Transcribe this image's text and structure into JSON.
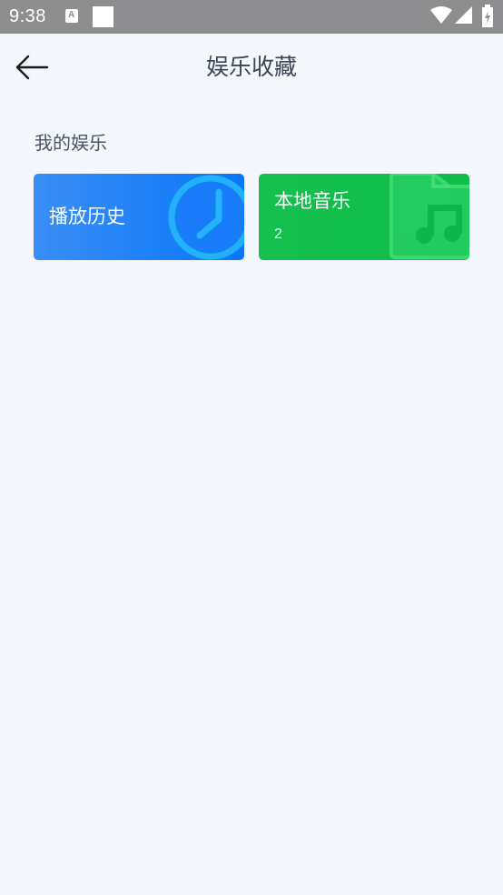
{
  "status_bar": {
    "time": "9:38",
    "app_icon_letter": "A"
  },
  "header": {
    "title": "娱乐收藏",
    "back_icon": "arrow-left-icon"
  },
  "section": {
    "title": "我的娱乐"
  },
  "cards": [
    {
      "label": "播放历史",
      "icon": "clock-icon",
      "color": "#1f82f8"
    },
    {
      "label": "本地音乐",
      "count": "2",
      "icon": "music-folder-icon",
      "color": "#0ebd4a"
    }
  ],
  "colors": {
    "background": "#f4f7fd",
    "status_bar": "#8e8e90",
    "title_text": "#3a4656"
  }
}
